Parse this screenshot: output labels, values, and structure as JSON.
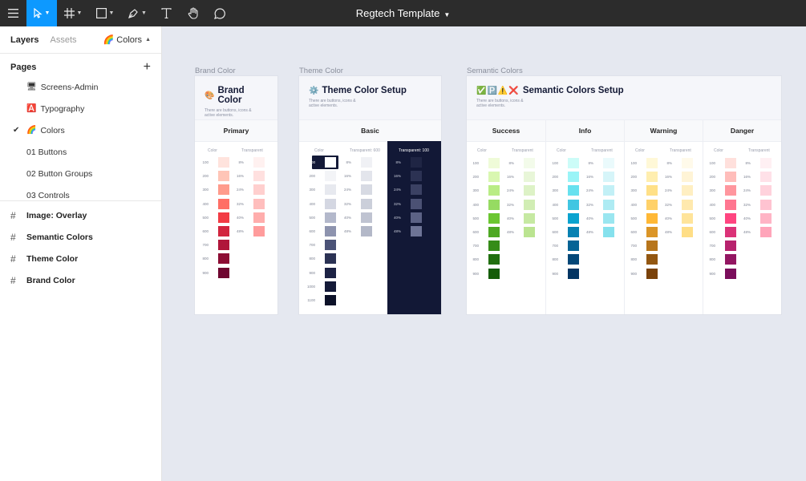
{
  "toolbar": {
    "title": "Regtech Template",
    "tools": [
      "menu-icon",
      "move-icon",
      "frame-icon",
      "shape-icon",
      "pen-icon",
      "text-icon",
      "hand-icon",
      "comment-icon"
    ]
  },
  "left_panel": {
    "tabs": {
      "layers": "Layers",
      "assets": "Assets"
    },
    "current_page": "🌈 Colors",
    "pages_heading": "Pages",
    "pages": [
      {
        "label": "Screens-Admin",
        "emoji": "🖥",
        "active": false
      },
      {
        "label": "Typography",
        "emoji": "🅰️",
        "active": false
      },
      {
        "label": "Colors",
        "emoji": "🌈",
        "active": true
      },
      {
        "label": "01 Buttons",
        "emoji": "",
        "active": false
      },
      {
        "label": "02 Button Groups",
        "emoji": "",
        "active": false
      },
      {
        "label": "03 Controls",
        "emoji": "",
        "active": false
      }
    ],
    "layers": [
      "Image: Overlay",
      "Semantic Colors",
      "Theme Color",
      "Brand Color"
    ]
  },
  "canvas": {
    "brand": {
      "label": "Brand Color",
      "title": "Brand Color",
      "emoji": "🎨",
      "subtitle": "There are buttons, icons & active elements.",
      "column": "Primary",
      "color_header": "Color",
      "transparent_header": "Transparent",
      "levels": [
        "100",
        "200",
        "300",
        "400",
        "500",
        "600",
        "700",
        "800",
        "900"
      ],
      "colors": [
        "#ffe3dd",
        "#ffc5b7",
        "#ff9b8c",
        "#ff6f66",
        "#f23c45",
        "#d2263f",
        "#b0163a",
        "#8c0c34",
        "#6f0630"
      ],
      "transparent_levels": [
        "8%",
        "16%",
        "24%",
        "32%",
        "40%",
        "48%"
      ],
      "transparent_colors": [
        "#fff1f0",
        "#ffe0df",
        "#ffcfce",
        "#ffbebd",
        "#ffadac",
        "#ff9c9c"
      ]
    },
    "theme": {
      "label": "Theme Color",
      "title": "Theme Color Setup",
      "emoji": "⚙️",
      "subtitle": "There are buttons, icons & active elements.",
      "column": "Basic",
      "color_header": "Color",
      "transparent_header": "Transparent: 600",
      "dark_header": "Transparent: 100",
      "levels": [
        "100",
        "200",
        "300",
        "400",
        "500",
        "600",
        "700",
        "800",
        "900",
        "1000",
        "1100"
      ],
      "colors": [
        "#ffffff",
        "#f3f4f7",
        "#e7e9ef",
        "#d4d7e2",
        "#b3b8cb",
        "#8d93ae",
        "#4b5377",
        "#2b3254",
        "#1c2244",
        "#141a38",
        "#0c1128"
      ],
      "transparent_levels": [
        "8%",
        "16%",
        "24%",
        "32%",
        "40%",
        "48%"
      ],
      "transparent_colors": [
        "#f0f1f5",
        "#e3e5ec",
        "#d7dae3",
        "#cbcfda",
        "#bfc3d1",
        "#b3b8c8"
      ],
      "dark_colors": [
        "#1f2544",
        "#2c3253",
        "#3b4163",
        "#4b5174",
        "#5c6285",
        "#6e7496"
      ]
    },
    "semantic": {
      "label": "Semantic Colors",
      "title": "Semantic Colors Setup",
      "emojis": [
        "✅",
        "🅿️",
        "⚠️",
        "❌"
      ],
      "subtitle": "There are buttons, icons & active elements.",
      "color_header": "Color",
      "transparent_header": "Transparent",
      "levels": [
        "100",
        "200",
        "300",
        "400",
        "500",
        "600",
        "700",
        "800",
        "900"
      ],
      "transparent_levels": [
        "8%",
        "16%",
        "24%",
        "32%",
        "40%",
        "48%"
      ],
      "columns": [
        {
          "name": "Success",
          "colors": [
            "#effbd8",
            "#d9f7b1",
            "#b9ec85",
            "#96db62",
            "#6bc631",
            "#4ea823",
            "#358c18",
            "#216f0f",
            "#155d08"
          ],
          "transparent_colors": [
            "#f3fbea",
            "#e8f6d8",
            "#ddf2c6",
            "#d1edb4",
            "#c6e9a2",
            "#bbe491"
          ]
        },
        {
          "name": "Info",
          "colors": [
            "#ccfcf8",
            "#9af4f7",
            "#67e1ef",
            "#41c6e2",
            "#0aa3cf",
            "#0781b2",
            "#056395",
            "#034778",
            "#023563"
          ],
          "transparent_colors": [
            "#eafafc",
            "#d6f5f9",
            "#c2f0f6",
            "#aeebf3",
            "#9ae6f0",
            "#86e1ed"
          ]
        },
        {
          "name": "Warning",
          "colors": [
            "#fff8d7",
            "#ffeeaf",
            "#ffe087",
            "#ffd169",
            "#ffb836",
            "#db9527",
            "#b7751b",
            "#935711",
            "#7a420a"
          ],
          "transparent_colors": [
            "#fffaea",
            "#fff4d6",
            "#ffefc2",
            "#ffe9ae",
            "#ffe49a",
            "#ffde86"
          ]
        },
        {
          "name": "Danger",
          "colors": [
            "#ffe0dc",
            "#ffbdba",
            "#ff969e",
            "#ff7690",
            "#ff4580",
            "#db3278",
            "#b7226d",
            "#931662",
            "#7a0d5b"
          ],
          "transparent_colors": [
            "#fff0f3",
            "#ffe1e8",
            "#ffd2dc",
            "#ffc3d1",
            "#ffb4c5",
            "#ffa5ba"
          ]
        }
      ]
    }
  }
}
